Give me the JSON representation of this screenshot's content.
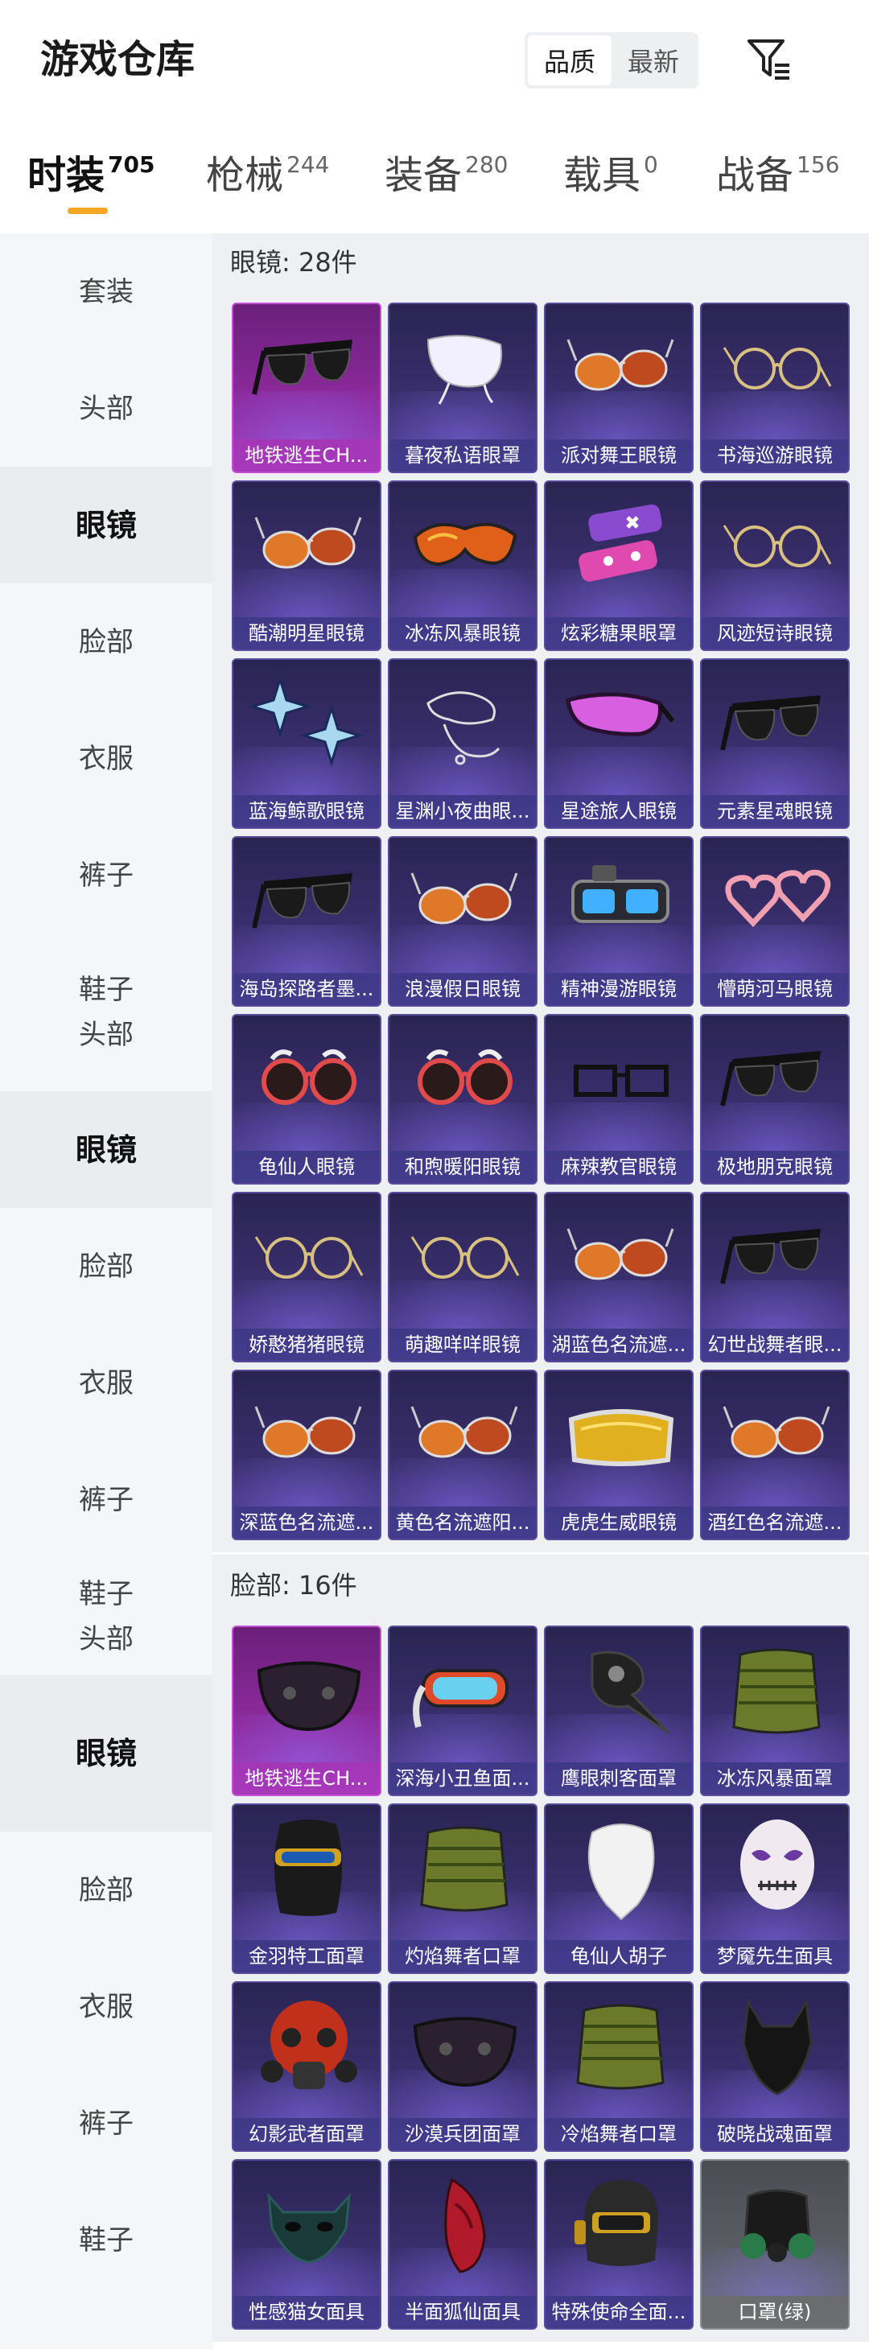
{
  "header": {
    "title": "游戏仓库",
    "sort_options": [
      "品质",
      "最新"
    ],
    "sort_selected": "品质",
    "filter_icon": "filter-icon"
  },
  "tabs": [
    {
      "label": "时装",
      "count": "705",
      "active": true
    },
    {
      "label": "枪械",
      "count": "244",
      "active": false
    },
    {
      "label": "装备",
      "count": "280",
      "active": false
    },
    {
      "label": "载具",
      "count": "0",
      "active": false
    },
    {
      "label": "战备",
      "count": "156",
      "active": false
    }
  ],
  "accent_color": "#f5a623",
  "sidebar": {
    "items": [
      {
        "label": "套装",
        "active": false
      },
      {
        "label": "头部",
        "active": false
      },
      {
        "label": "眼镜",
        "active": true
      },
      {
        "label": "脸部",
        "active": false
      },
      {
        "label": "衣服",
        "active": false
      },
      {
        "label": "裤子",
        "active": false
      },
      {
        "label": "鞋子\n头部",
        "active": false
      },
      {
        "label": "眼镜",
        "active": true
      },
      {
        "label": "脸部",
        "active": false
      },
      {
        "label": "衣服",
        "active": false
      },
      {
        "label": "裤子",
        "active": false
      },
      {
        "label": "鞋子\n头部",
        "active": false
      },
      {
        "label": "眼镜",
        "active": true
      },
      {
        "label": "脸部",
        "active": false
      },
      {
        "label": "衣服",
        "active": false
      },
      {
        "label": "裤子",
        "active": false
      },
      {
        "label": "鞋子",
        "active": false
      }
    ]
  },
  "sections": [
    {
      "title": "眼镜: 28件",
      "items": [
        {
          "name": "地铁逃生CH...",
          "rarity": "legend",
          "icon": "sunglasses-icon"
        },
        {
          "name": "暮夜私语眼罩",
          "rarity": "epic",
          "icon": "eye-mask-icon"
        },
        {
          "name": "派对舞王眼镜",
          "rarity": "epic",
          "icon": "aviator-glasses-icon"
        },
        {
          "name": "书海巡游眼镜",
          "rarity": "epic",
          "icon": "round-glasses-icon"
        },
        {
          "name": "酷潮明星眼镜",
          "rarity": "epic",
          "icon": "aviator-glasses-icon"
        },
        {
          "name": "冰冻风暴眼镜",
          "rarity": "epic",
          "icon": "sport-goggles-icon"
        },
        {
          "name": "炫彩糖果眼罩",
          "rarity": "epic",
          "icon": "candy-mask-icon"
        },
        {
          "name": "风迹短诗眼镜",
          "rarity": "epic",
          "icon": "round-glasses-icon"
        },
        {
          "name": "蓝海鲸歌眼镜",
          "rarity": "epic",
          "icon": "star-glasses-icon"
        },
        {
          "name": "星渊小夜曲眼...",
          "rarity": "epic",
          "icon": "wire-mask-icon"
        },
        {
          "name": "星途旅人眼镜",
          "rarity": "epic",
          "icon": "visor-glasses-icon"
        },
        {
          "name": "元素星魂眼镜",
          "rarity": "epic",
          "icon": "sunglasses-icon"
        },
        {
          "name": "海岛探路者墨...",
          "rarity": "epic",
          "icon": "sunglasses-icon"
        },
        {
          "name": "浪漫假日眼镜",
          "rarity": "epic",
          "icon": "aviator-glasses-icon"
        },
        {
          "name": "精神漫游眼镜",
          "rarity": "epic",
          "icon": "cyber-goggles-icon"
        },
        {
          "name": "懵萌河马眼镜",
          "rarity": "epic",
          "icon": "heart-glasses-icon"
        },
        {
          "name": "龟仙人眼镜",
          "rarity": "epic",
          "icon": "round-sunglasses-icon"
        },
        {
          "name": "和煦暖阳眼镜",
          "rarity": "epic",
          "icon": "round-sunglasses-icon"
        },
        {
          "name": "麻辣教官眼镜",
          "rarity": "epic",
          "icon": "square-glasses-icon"
        },
        {
          "name": "极地朋克眼镜",
          "rarity": "epic",
          "icon": "sunglasses-icon"
        },
        {
          "name": "娇憨猪猪眼镜",
          "rarity": "epic",
          "icon": "round-glasses-icon"
        },
        {
          "name": "萌趣咩咩眼镜",
          "rarity": "epic",
          "icon": "round-glasses-icon"
        },
        {
          "name": "湖蓝色名流遮...",
          "rarity": "epic",
          "icon": "aviator-glasses-icon"
        },
        {
          "name": "幻世战舞者眼...",
          "rarity": "epic",
          "icon": "sunglasses-icon"
        },
        {
          "name": "深蓝色名流遮...",
          "rarity": "epic",
          "icon": "aviator-glasses-icon"
        },
        {
          "name": "黄色名流遮阳...",
          "rarity": "epic",
          "icon": "aviator-glasses-icon"
        },
        {
          "name": "虎虎生威眼镜",
          "rarity": "epic",
          "icon": "ski-goggles-icon"
        },
        {
          "name": "酒红色名流遮...",
          "rarity": "epic",
          "icon": "aviator-glasses-icon"
        }
      ]
    },
    {
      "title": "脸部: 16件",
      "items": [
        {
          "name": "地铁逃生CH...",
          "rarity": "legend",
          "icon": "face-mask-icon"
        },
        {
          "name": "深海小丑鱼面...",
          "rarity": "epic",
          "icon": "snorkel-mask-icon"
        },
        {
          "name": "鹰眼刺客面罩",
          "rarity": "epic",
          "icon": "plague-mask-icon"
        },
        {
          "name": "冰冻风暴面罩",
          "rarity": "epic",
          "icon": "neck-gaiter-icon"
        },
        {
          "name": "金羽特工面罩",
          "rarity": "epic",
          "icon": "balaclava-icon"
        },
        {
          "name": "灼焰舞者口罩",
          "rarity": "epic",
          "icon": "neck-gaiter-icon"
        },
        {
          "name": "龟仙人胡子",
          "rarity": "epic",
          "icon": "beard-icon"
        },
        {
          "name": "梦魇先生面具",
          "rarity": "epic",
          "icon": "skull-mask-icon"
        },
        {
          "name": "幻影武者面罩",
          "rarity": "epic",
          "icon": "gas-mask-icon"
        },
        {
          "name": "沙漠兵团面罩",
          "rarity": "epic",
          "icon": "face-mask-icon"
        },
        {
          "name": "冷焰舞者口罩",
          "rarity": "epic",
          "icon": "neck-gaiter-icon"
        },
        {
          "name": "破晓战魂面罩",
          "rarity": "epic",
          "icon": "wolf-mask-icon"
        },
        {
          "name": "性感猫女面具",
          "rarity": "epic",
          "icon": "cat-mask-icon"
        },
        {
          "name": "半面狐仙面具",
          "rarity": "epic",
          "icon": "fox-mask-icon"
        },
        {
          "name": "特殊使命全面...",
          "rarity": "epic",
          "icon": "helmet-mask-icon"
        },
        {
          "name": "口罩(绿)",
          "rarity": "gray",
          "icon": "respirator-icon"
        }
      ]
    }
  ]
}
